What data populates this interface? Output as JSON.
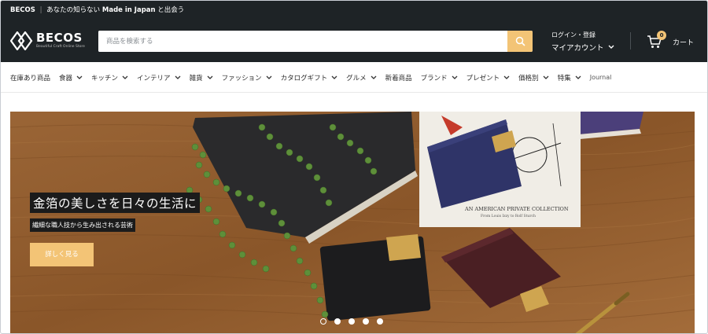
{
  "announcement": {
    "brand": "BECOS",
    "separator": "|",
    "prefix": "あなたの知らない",
    "highlight": "Made in Japan",
    "suffix": "と出会う"
  },
  "header": {
    "logo_text": "BECOS",
    "logo_tagline": "Beautiful Craft Online Store",
    "search_placeholder": "商品を検索する",
    "account_line1": "ログイン・登録",
    "account_line2": "マイアカウント",
    "cart_count": "0",
    "cart_label": "カート"
  },
  "nav": {
    "items": [
      {
        "label": "在庫あり商品",
        "has_dropdown": false
      },
      {
        "label": "食器",
        "has_dropdown": true
      },
      {
        "label": "キッチン",
        "has_dropdown": true
      },
      {
        "label": "インテリア",
        "has_dropdown": true
      },
      {
        "label": "雑貨",
        "has_dropdown": true
      },
      {
        "label": "ファッション",
        "has_dropdown": true
      },
      {
        "label": "カタログギフト",
        "has_dropdown": true
      },
      {
        "label": "グルメ",
        "has_dropdown": true
      },
      {
        "label": "新着商品",
        "has_dropdown": false
      },
      {
        "label": "ブランド",
        "has_dropdown": true
      },
      {
        "label": "プレゼント",
        "has_dropdown": true
      },
      {
        "label": "価格別",
        "has_dropdown": true
      },
      {
        "label": "特集",
        "has_dropdown": true
      },
      {
        "label": "Journal",
        "has_dropdown": false
      }
    ]
  },
  "hero": {
    "title": "金箔の美しさを日々の生活に",
    "subtitle": "繊細な職人技から生み出される芸術",
    "cta_label": "詳しく見る",
    "book_caption_1": "AN AMERICAN PRIVATE COLLECTION",
    "book_caption_2": "From Louis Izzy to Rolf Sturch",
    "slides": 5,
    "active_slide": 1
  },
  "colors": {
    "header_bg": "#1e2326",
    "accent": "#f3c476",
    "hero_wood": "#8c5a30"
  }
}
